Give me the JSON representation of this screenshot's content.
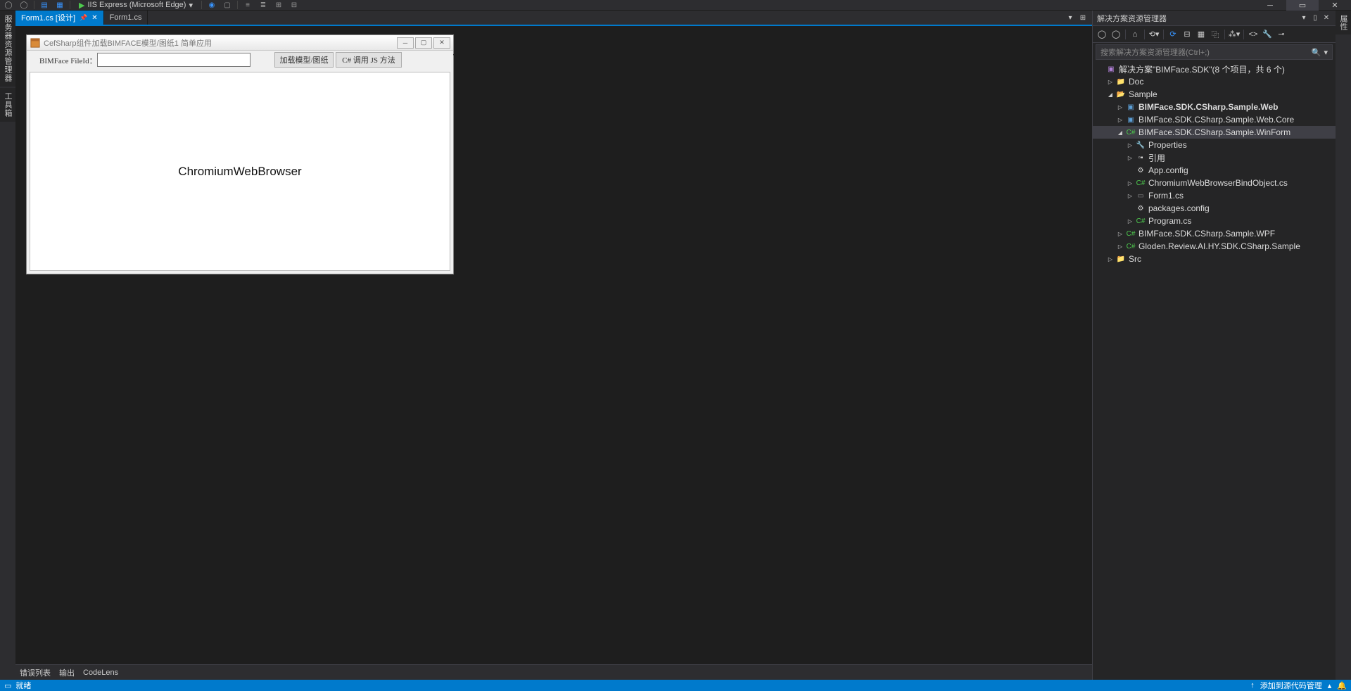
{
  "topToolbar": {
    "runTarget": "IIS Express (Microsoft Edge)"
  },
  "leftDock": {
    "tab1": "服务器资源管理器",
    "tab2": "工具箱"
  },
  "rightDock": {
    "tab1": "属性"
  },
  "docTabs": {
    "active": "Form1.cs [设计]",
    "inactive": "Form1.cs"
  },
  "designer": {
    "formTitle": "CefSharp组件加载BIMFACE模型/图纸1  简单应用",
    "labelFileId": "BIMFace FileId：",
    "btnLoad": "加载模型/图纸",
    "btnCallJs": "C# 调用 JS 方法",
    "browserPlaceholder": "ChromiumWebBrowser"
  },
  "bottomPanel": {
    "tab1": "错误列表",
    "tab2": "输出",
    "tab3": "CodeLens"
  },
  "slnPanel": {
    "title": "解决方案资源管理器",
    "searchPlaceholder": "搜索解决方案资源管理器(Ctrl+;)",
    "root": "解决方案\"BIMFace.SDK\"(8 个项目，共 6 个)",
    "nodes": {
      "doc": "Doc",
      "sample": "Sample",
      "sampleWeb": "BIMFace.SDK.CSharp.Sample.Web",
      "sampleWebCore": "BIMFace.SDK.CSharp.Sample.Web.Core",
      "sampleWinForm": "BIMFace.SDK.CSharp.Sample.WinForm",
      "properties": "Properties",
      "references": "引用",
      "appConfig": "App.config",
      "bindObject": "ChromiumWebBrowserBindObject.cs",
      "form1": "Form1.cs",
      "packagesConfig": "packages.config",
      "program": "Program.cs",
      "sampleWpf": "BIMFace.SDK.CSharp.Sample.WPF",
      "gloden": "Gloden.Review.AI.HY.SDK.CSharp.Sample",
      "src": "Src"
    }
  },
  "statusBar": {
    "ready": "就绪",
    "addToSource": "添加到源代码管理"
  }
}
